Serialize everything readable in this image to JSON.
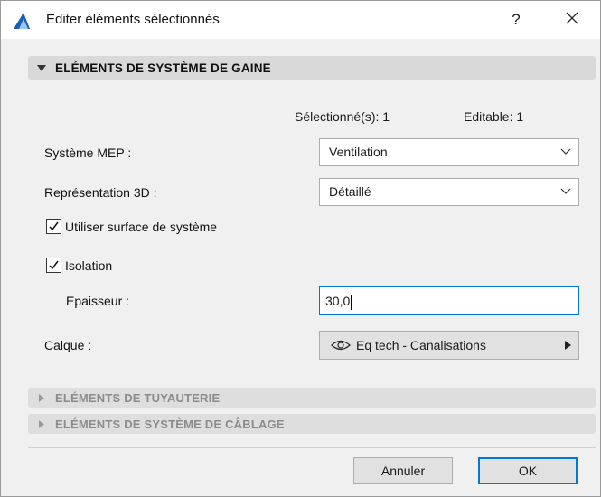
{
  "window": {
    "title": "Editer éléments sélectionnés",
    "help": "?",
    "close": "✕"
  },
  "sections": {
    "duct": {
      "label": "ELÉMENTS DE SYSTÈME DE GAINE",
      "expanded": true
    },
    "pipe": {
      "label": "ELÉMENTS DE TUYAUTERIE",
      "expanded": false
    },
    "cable": {
      "label": "ELÉMENTS DE SYSTÈME DE CÂBLAGE",
      "expanded": false
    }
  },
  "counts": {
    "selected": "Sélectionné(s): 1",
    "editable": "Editable: 1"
  },
  "fields": {
    "mep_system": {
      "label": "Système MEP :",
      "value": "Ventilation"
    },
    "representation": {
      "label": "Représentation 3D :",
      "value": "Détaillé"
    },
    "use_system_surface": {
      "label": "Utiliser surface de système",
      "checked": true
    },
    "insulation": {
      "label": "Isolation",
      "checked": true
    },
    "thickness": {
      "label": "Epaisseur :",
      "value": "30,0"
    },
    "layer": {
      "label": "Calque :",
      "value": "Eq tech - Canalisations",
      "icon": "eye-icon"
    }
  },
  "buttons": {
    "cancel": "Annuler",
    "ok": "OK"
  },
  "colors": {
    "accent": "#0078d7",
    "header_bg": "#d9d9d9",
    "dialog_bg": "#f0f0f0"
  }
}
